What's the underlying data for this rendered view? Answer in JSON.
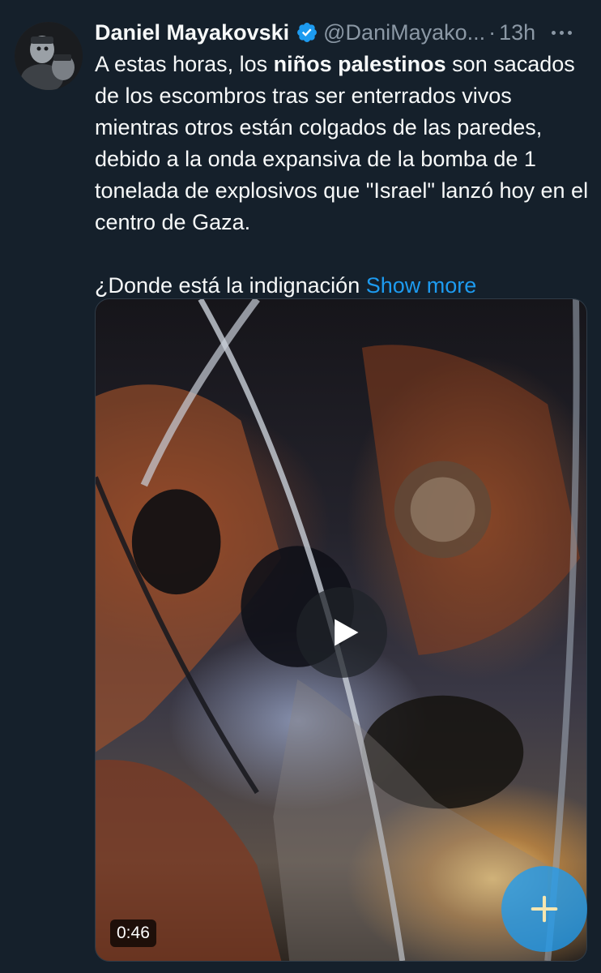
{
  "author": {
    "name": "Daniel Mayakovski",
    "handle": "@DaniMayako...",
    "separator": "·",
    "time": "13h"
  },
  "tweet": {
    "line1_pre": "A estas horas, los ",
    "line1_bold": "niños palestinos",
    "line1_post": " son sacados de los escombros tras ser enterrados vivos mientras otros están colgados de las paredes, debido a la onda expansiva de la bomba de 1 tonelada de explosivos que \"Israel\" lanzó hoy en el centro de Gaza.",
    "line2": "¿Donde está la indignación ",
    "show_more": "Show more"
  },
  "media": {
    "duration": "0:46"
  },
  "icons": {
    "verified": "verified-badge-icon",
    "more": "more-icon",
    "play": "play-icon",
    "compose": "compose-plus-icon"
  },
  "colors": {
    "background": "#15202b",
    "accent": "#1d9bf0",
    "secondary_text": "#8b98a5"
  }
}
